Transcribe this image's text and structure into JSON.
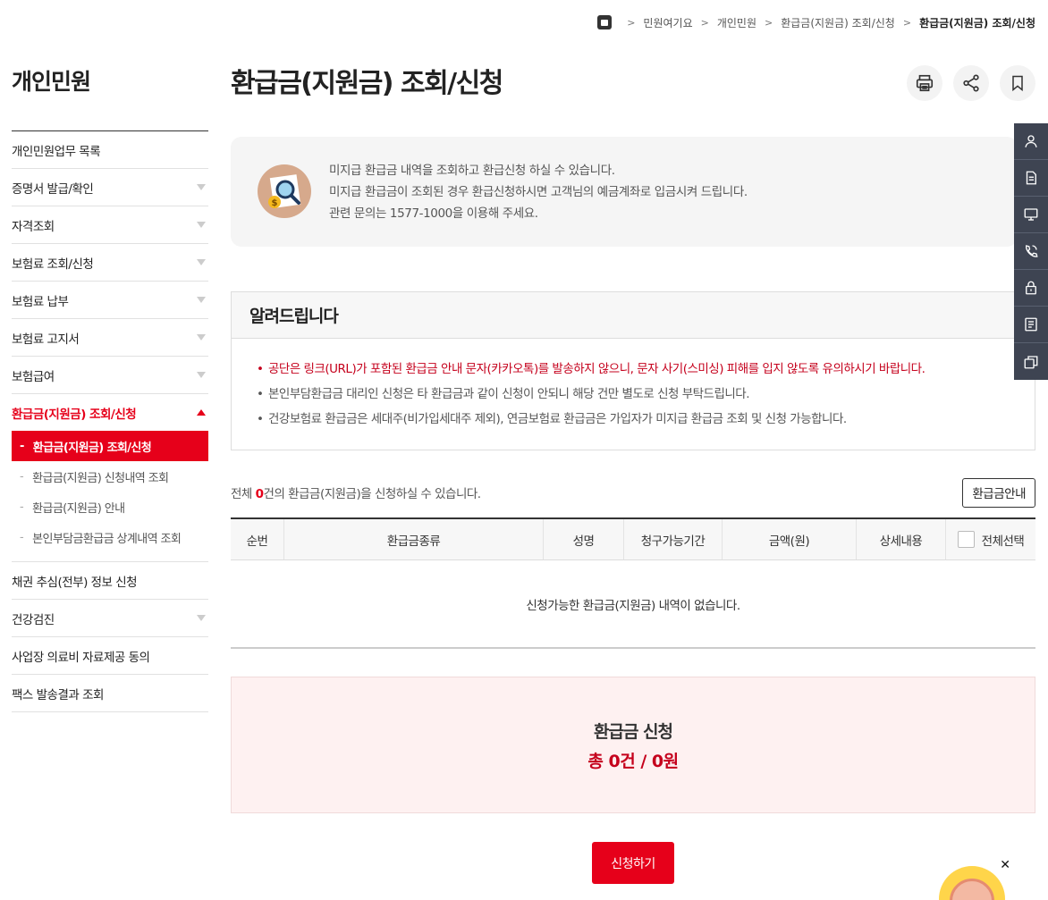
{
  "breadcrumb": {
    "items": [
      "민원여기요",
      "개인민원",
      "환급금(지원금) 조회/신청",
      "환급금(지원금) 조회/신청"
    ]
  },
  "sidebar": {
    "title": "개인민원",
    "items": [
      {
        "label": "개인민원업무 목록"
      },
      {
        "label": "증명서 발급/확인"
      },
      {
        "label": "자격조회"
      },
      {
        "label": "보험료 조회/신청"
      },
      {
        "label": "보험료 납부"
      },
      {
        "label": "보험료 고지서"
      },
      {
        "label": "보험급여"
      },
      {
        "label": "환급금(지원금) 조회/신청"
      },
      {
        "label": "채권 추심(전부) 정보 신청"
      },
      {
        "label": "건강검진"
      },
      {
        "label": "사업장 의료비 자료제공 동의"
      },
      {
        "label": "팩스 발송결과 조회"
      }
    ],
    "submenu": [
      {
        "label": "환급금(지원금) 조회/신청"
      },
      {
        "label": "환급금(지원금) 신청내역 조회"
      },
      {
        "label": "환급금(지원금) 안내"
      },
      {
        "label": "본인부담금환급금 상계내역 조회"
      }
    ]
  },
  "main": {
    "title": "환급금(지원금) 조회/신청",
    "info": [
      "미지급 환급금 내역을 조회하고 환급신청 하실 수 있습니다.",
      "미지급 환급금이 조회된 경우 환급신청하시면 고객님의 예금계좌로 입금시켜 드립니다.",
      "관련 문의는 1577-1000을 이용해 주세요."
    ],
    "notice": {
      "title": "알려드립니다",
      "items": [
        "공단은 링크(URL)가 포함된 환급금 안내 문자(카카오톡)를 발송하지 않으니, 문자 사기(스미싱) 피해를 입지 않도록 유의하시기 바랍니다.",
        "본인부담환급금 대리인 신청은 타 환급금과 같이 신청이 안되니 해당 건만 별도로 신청 부탁드립니다.",
        "건강보험료 환급금은 세대주(비가입세대주 제외), 연금보험료 환급금은 가입자가 미지급 환급금 조회 및 신청 가능합니다."
      ]
    },
    "count": {
      "prefix": "전체 ",
      "num": "0",
      "suffix": "건의 환급금(지원금)을 신청하실 수 있습니다."
    },
    "guide_button": "환급금안내",
    "table": {
      "headers": [
        "순번",
        "환급금종류",
        "성명",
        "청구가능기간",
        "금액(원)",
        "상세내용",
        "전체선택"
      ],
      "empty": "신청가능한 환급금(지원금) 내역이 없습니다."
    },
    "apply": {
      "title": "환급금 신청",
      "total": "총 0건 / 0원"
    },
    "apply_button": "신청하기"
  },
  "colors": {
    "accent": "#e6001a",
    "quickmenu": "#3e4452"
  },
  "icons": [
    "home-icon",
    "print-icon",
    "share-icon",
    "bookmark-icon",
    "person-icon",
    "document-icon",
    "monitor-icon",
    "phone-icon",
    "lock-icon",
    "list-icon",
    "copy-icon",
    "close-icon",
    "chatbot-icon"
  ]
}
